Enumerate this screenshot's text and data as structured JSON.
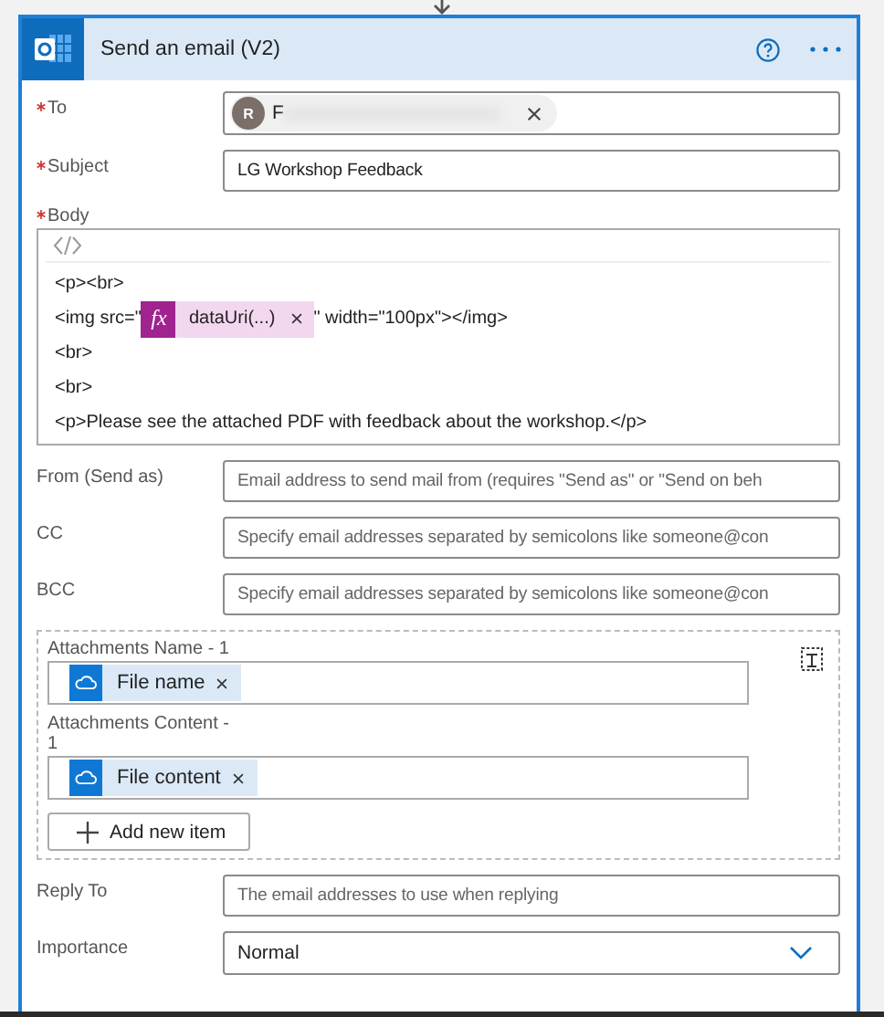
{
  "action": {
    "title": "Send an email (V2)"
  },
  "fields": [
    {
      "kind": "recipients",
      "label": "To",
      "required": true,
      "tokens": [
        {
          "avatar": "R",
          "text": "F"
        }
      ]
    },
    {
      "kind": "text",
      "label": "Subject",
      "required": true,
      "value": "LG Workshop Feedback"
    },
    {
      "kind": "code",
      "label": "Body",
      "required": true,
      "lines": [
        {
          "text": "<p><br>"
        },
        {
          "before": "<img src=\"",
          "token": {
            "badge": "fx",
            "text": "dataUri(...)"
          },
          "after": "\" width=\"100px\"></img>"
        },
        {
          "text": "<br>"
        },
        {
          "text": "<br>"
        },
        {
          "text": "<p>Please see the attached PDF with feedback about the workshop.</p>"
        }
      ]
    },
    {
      "kind": "text",
      "label": "From (Send as)",
      "required": false,
      "placeholder": "Email address to send mail from (requires \"Send as\" or \"Send on beh"
    },
    {
      "kind": "text",
      "label": "CC",
      "required": false,
      "placeholder": "Specify email addresses separated by semicolons like someone@con"
    },
    {
      "kind": "text",
      "label": "BCC",
      "required": false,
      "placeholder": "Specify email addresses separated by semicolons like someone@con"
    },
    {
      "kind": "array",
      "items": [
        {
          "label": "Attachments Name - 1",
          "token": {
            "text": "File name"
          }
        },
        {
          "label": "Attachments Content - 1",
          "token": {
            "text": "File content"
          }
        }
      ],
      "add_button": "Add new item"
    },
    {
      "kind": "text",
      "label": "Reply To",
      "required": false,
      "placeholder": "The email addresses to use when replying"
    },
    {
      "kind": "select",
      "label": "Importance",
      "required": false,
      "value": "Normal"
    }
  ]
}
